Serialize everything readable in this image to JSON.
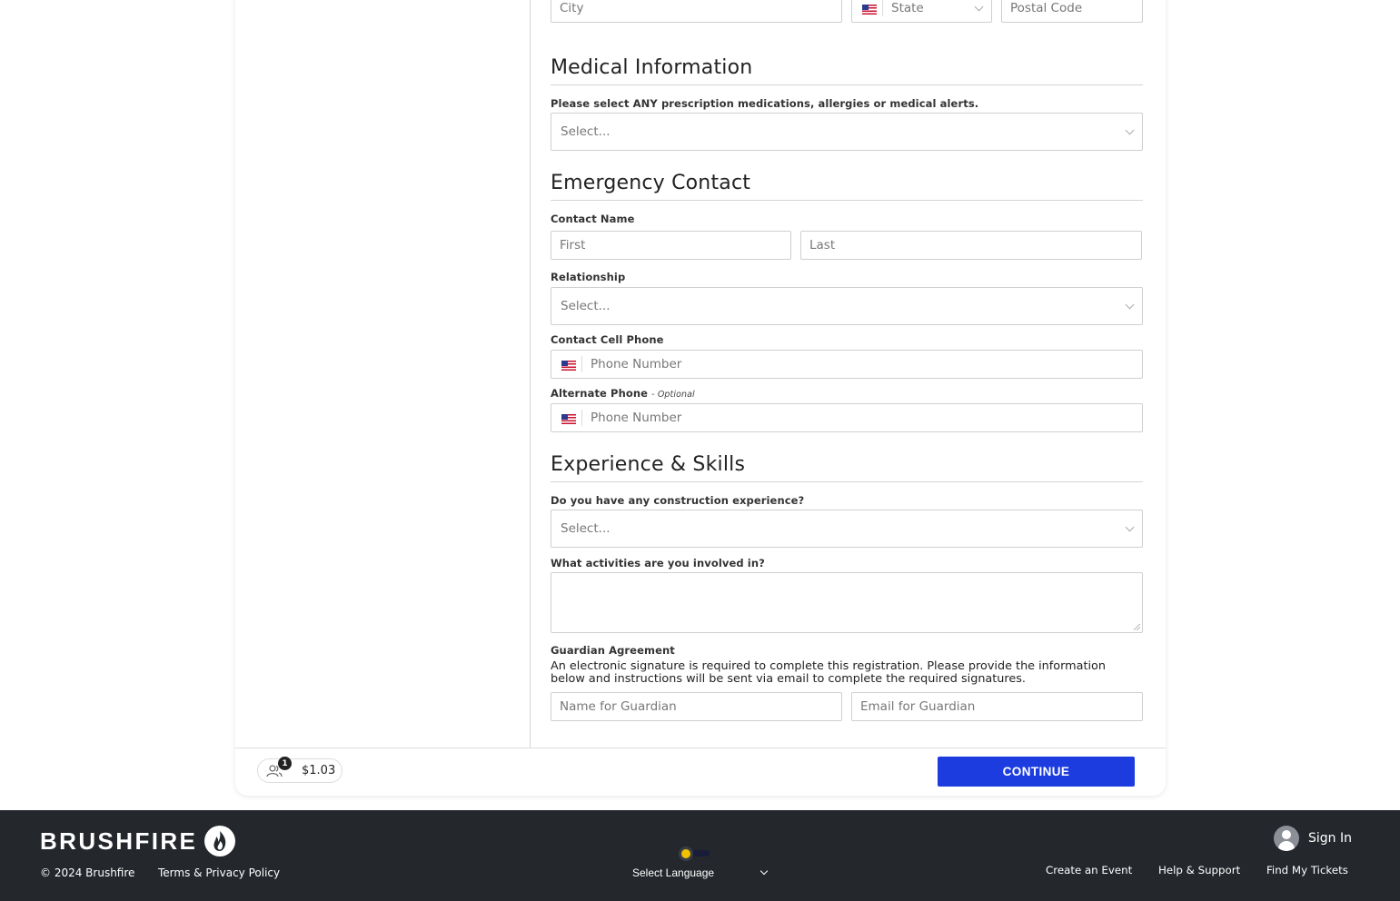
{
  "address": {
    "city_placeholder": "City",
    "state_placeholder": "State",
    "postal_placeholder": "Postal Code"
  },
  "medical": {
    "heading": "Medical Information",
    "label": "Please select ANY prescription medications, allergies or medical alerts.",
    "select_value": "Select..."
  },
  "emergency": {
    "heading": "Emergency Contact",
    "name_label": "Contact Name",
    "first_placeholder": "First",
    "last_placeholder": "Last",
    "relationship_label": "Relationship",
    "relationship_value": "Select...",
    "cell_label": "Contact Cell Phone",
    "cell_placeholder": "Phone Number",
    "alt_label": "Alternate Phone",
    "alt_optional": "- Optional",
    "alt_placeholder": "Phone Number"
  },
  "experience": {
    "heading": "Experience & Skills",
    "construction_label": "Do you have any construction experience?",
    "construction_value": "Select...",
    "activities_label": "What activities are you involved in?",
    "activities_value": ""
  },
  "guardian": {
    "label": "Guardian Agreement",
    "text": "An electronic signature is required to complete this registration. Please provide the information below and instructions will be sent via email to complete the required signatures.",
    "name_placeholder": "Name for Guardian",
    "email_placeholder": "Email for Guardian"
  },
  "cart": {
    "count": "1",
    "total": "$1.03",
    "icon": "people-icon"
  },
  "actions": {
    "continue_label": "CONTINUE",
    "accent_color": "#1c3ce0"
  },
  "footer": {
    "logo_text": "BRUSHFIRE",
    "copyright": "© 2024 Brushfire",
    "terms": "Terms & Privacy Policy",
    "language_label": "Select Language",
    "sign_in": "Sign In",
    "links": [
      "Create an Event",
      "Help & Support",
      "Find My Tickets"
    ],
    "background_color": "#24272c"
  }
}
